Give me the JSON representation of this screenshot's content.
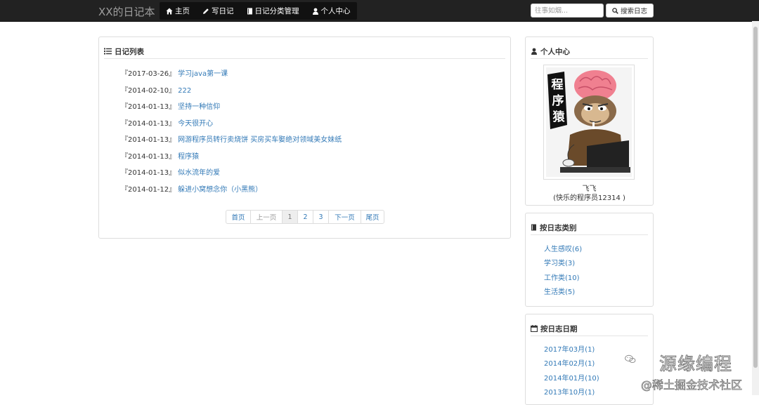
{
  "navbar": {
    "brand": "XX的日记本",
    "items": [
      {
        "label": "主页",
        "icon": "home-icon"
      },
      {
        "label": "写日记",
        "icon": "pencil-icon"
      },
      {
        "label": "日记分类管理",
        "icon": "book-icon"
      },
      {
        "label": "个人中心",
        "icon": "user-icon"
      }
    ],
    "search_placeholder": "往事如烟...",
    "search_label": "搜索日志"
  },
  "diary_panel": {
    "title": "日记列表",
    "items": [
      {
        "date": "『2017-03-26』",
        "title": "学习java第一课"
      },
      {
        "date": "『2014-02-10』",
        "title": "222"
      },
      {
        "date": "『2014-01-13』",
        "title": "坚持一种信仰"
      },
      {
        "date": "『2014-01-13』",
        "title": "今天很开心"
      },
      {
        "date": "『2014-01-13』",
        "title": "网游程序员转行卖烧饼 买房买车娶绝对领域美女妹纸"
      },
      {
        "date": "『2014-01-13』",
        "title": "程序猿"
      },
      {
        "date": "『2014-01-13』",
        "title": "似水流年的爱"
      },
      {
        "date": "『2014-01-12』",
        "title": "躲进小窝想念你（小黑熊）"
      }
    ],
    "pagination": {
      "first": "首页",
      "prev": "上一页",
      "pages": [
        "1",
        "2",
        "3"
      ],
      "current": "1",
      "next": "下一页",
      "last": "尾页"
    }
  },
  "profile_panel": {
    "title": "个人中心",
    "avatar_text": "程序猿",
    "nickname": "飞飞",
    "signature": "(快乐的程序员12314 )"
  },
  "category_panel": {
    "title": "按日志类别",
    "items": [
      "人生感叹(6)",
      "学习类(3)",
      "工作类(10)",
      "生活类(5)"
    ]
  },
  "date_panel": {
    "title": "按日志日期",
    "items": [
      "2017年03月(1)",
      "2014年02月(1)",
      "2014年01月(10)",
      "2013年10月(1)"
    ]
  },
  "watermark": {
    "name": "源缘编程",
    "sub": "@稀土掘金技术社区"
  }
}
